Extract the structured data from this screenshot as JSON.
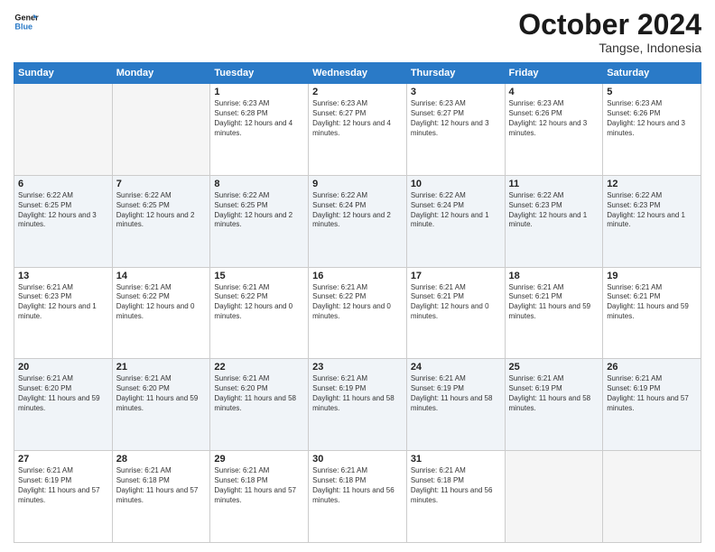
{
  "header": {
    "logo_line1": "General",
    "logo_line2": "Blue",
    "month": "October 2024",
    "location": "Tangse, Indonesia"
  },
  "days_of_week": [
    "Sunday",
    "Monday",
    "Tuesday",
    "Wednesday",
    "Thursday",
    "Friday",
    "Saturday"
  ],
  "weeks": [
    [
      {
        "num": "",
        "info": ""
      },
      {
        "num": "",
        "info": ""
      },
      {
        "num": "1",
        "info": "Sunrise: 6:23 AM\nSunset: 6:28 PM\nDaylight: 12 hours and 4 minutes."
      },
      {
        "num": "2",
        "info": "Sunrise: 6:23 AM\nSunset: 6:27 PM\nDaylight: 12 hours and 4 minutes."
      },
      {
        "num": "3",
        "info": "Sunrise: 6:23 AM\nSunset: 6:27 PM\nDaylight: 12 hours and 3 minutes."
      },
      {
        "num": "4",
        "info": "Sunrise: 6:23 AM\nSunset: 6:26 PM\nDaylight: 12 hours and 3 minutes."
      },
      {
        "num": "5",
        "info": "Sunrise: 6:23 AM\nSunset: 6:26 PM\nDaylight: 12 hours and 3 minutes."
      }
    ],
    [
      {
        "num": "6",
        "info": "Sunrise: 6:22 AM\nSunset: 6:25 PM\nDaylight: 12 hours and 3 minutes."
      },
      {
        "num": "7",
        "info": "Sunrise: 6:22 AM\nSunset: 6:25 PM\nDaylight: 12 hours and 2 minutes."
      },
      {
        "num": "8",
        "info": "Sunrise: 6:22 AM\nSunset: 6:25 PM\nDaylight: 12 hours and 2 minutes."
      },
      {
        "num": "9",
        "info": "Sunrise: 6:22 AM\nSunset: 6:24 PM\nDaylight: 12 hours and 2 minutes."
      },
      {
        "num": "10",
        "info": "Sunrise: 6:22 AM\nSunset: 6:24 PM\nDaylight: 12 hours and 1 minute."
      },
      {
        "num": "11",
        "info": "Sunrise: 6:22 AM\nSunset: 6:23 PM\nDaylight: 12 hours and 1 minute."
      },
      {
        "num": "12",
        "info": "Sunrise: 6:22 AM\nSunset: 6:23 PM\nDaylight: 12 hours and 1 minute."
      }
    ],
    [
      {
        "num": "13",
        "info": "Sunrise: 6:21 AM\nSunset: 6:23 PM\nDaylight: 12 hours and 1 minute."
      },
      {
        "num": "14",
        "info": "Sunrise: 6:21 AM\nSunset: 6:22 PM\nDaylight: 12 hours and 0 minutes."
      },
      {
        "num": "15",
        "info": "Sunrise: 6:21 AM\nSunset: 6:22 PM\nDaylight: 12 hours and 0 minutes."
      },
      {
        "num": "16",
        "info": "Sunrise: 6:21 AM\nSunset: 6:22 PM\nDaylight: 12 hours and 0 minutes."
      },
      {
        "num": "17",
        "info": "Sunrise: 6:21 AM\nSunset: 6:21 PM\nDaylight: 12 hours and 0 minutes."
      },
      {
        "num": "18",
        "info": "Sunrise: 6:21 AM\nSunset: 6:21 PM\nDaylight: 11 hours and 59 minutes."
      },
      {
        "num": "19",
        "info": "Sunrise: 6:21 AM\nSunset: 6:21 PM\nDaylight: 11 hours and 59 minutes."
      }
    ],
    [
      {
        "num": "20",
        "info": "Sunrise: 6:21 AM\nSunset: 6:20 PM\nDaylight: 11 hours and 59 minutes."
      },
      {
        "num": "21",
        "info": "Sunrise: 6:21 AM\nSunset: 6:20 PM\nDaylight: 11 hours and 59 minutes."
      },
      {
        "num": "22",
        "info": "Sunrise: 6:21 AM\nSunset: 6:20 PM\nDaylight: 11 hours and 58 minutes."
      },
      {
        "num": "23",
        "info": "Sunrise: 6:21 AM\nSunset: 6:19 PM\nDaylight: 11 hours and 58 minutes."
      },
      {
        "num": "24",
        "info": "Sunrise: 6:21 AM\nSunset: 6:19 PM\nDaylight: 11 hours and 58 minutes."
      },
      {
        "num": "25",
        "info": "Sunrise: 6:21 AM\nSunset: 6:19 PM\nDaylight: 11 hours and 58 minutes."
      },
      {
        "num": "26",
        "info": "Sunrise: 6:21 AM\nSunset: 6:19 PM\nDaylight: 11 hours and 57 minutes."
      }
    ],
    [
      {
        "num": "27",
        "info": "Sunrise: 6:21 AM\nSunset: 6:19 PM\nDaylight: 11 hours and 57 minutes."
      },
      {
        "num": "28",
        "info": "Sunrise: 6:21 AM\nSunset: 6:18 PM\nDaylight: 11 hours and 57 minutes."
      },
      {
        "num": "29",
        "info": "Sunrise: 6:21 AM\nSunset: 6:18 PM\nDaylight: 11 hours and 57 minutes."
      },
      {
        "num": "30",
        "info": "Sunrise: 6:21 AM\nSunset: 6:18 PM\nDaylight: 11 hours and 56 minutes."
      },
      {
        "num": "31",
        "info": "Sunrise: 6:21 AM\nSunset: 6:18 PM\nDaylight: 11 hours and 56 minutes."
      },
      {
        "num": "",
        "info": ""
      },
      {
        "num": "",
        "info": ""
      }
    ]
  ]
}
